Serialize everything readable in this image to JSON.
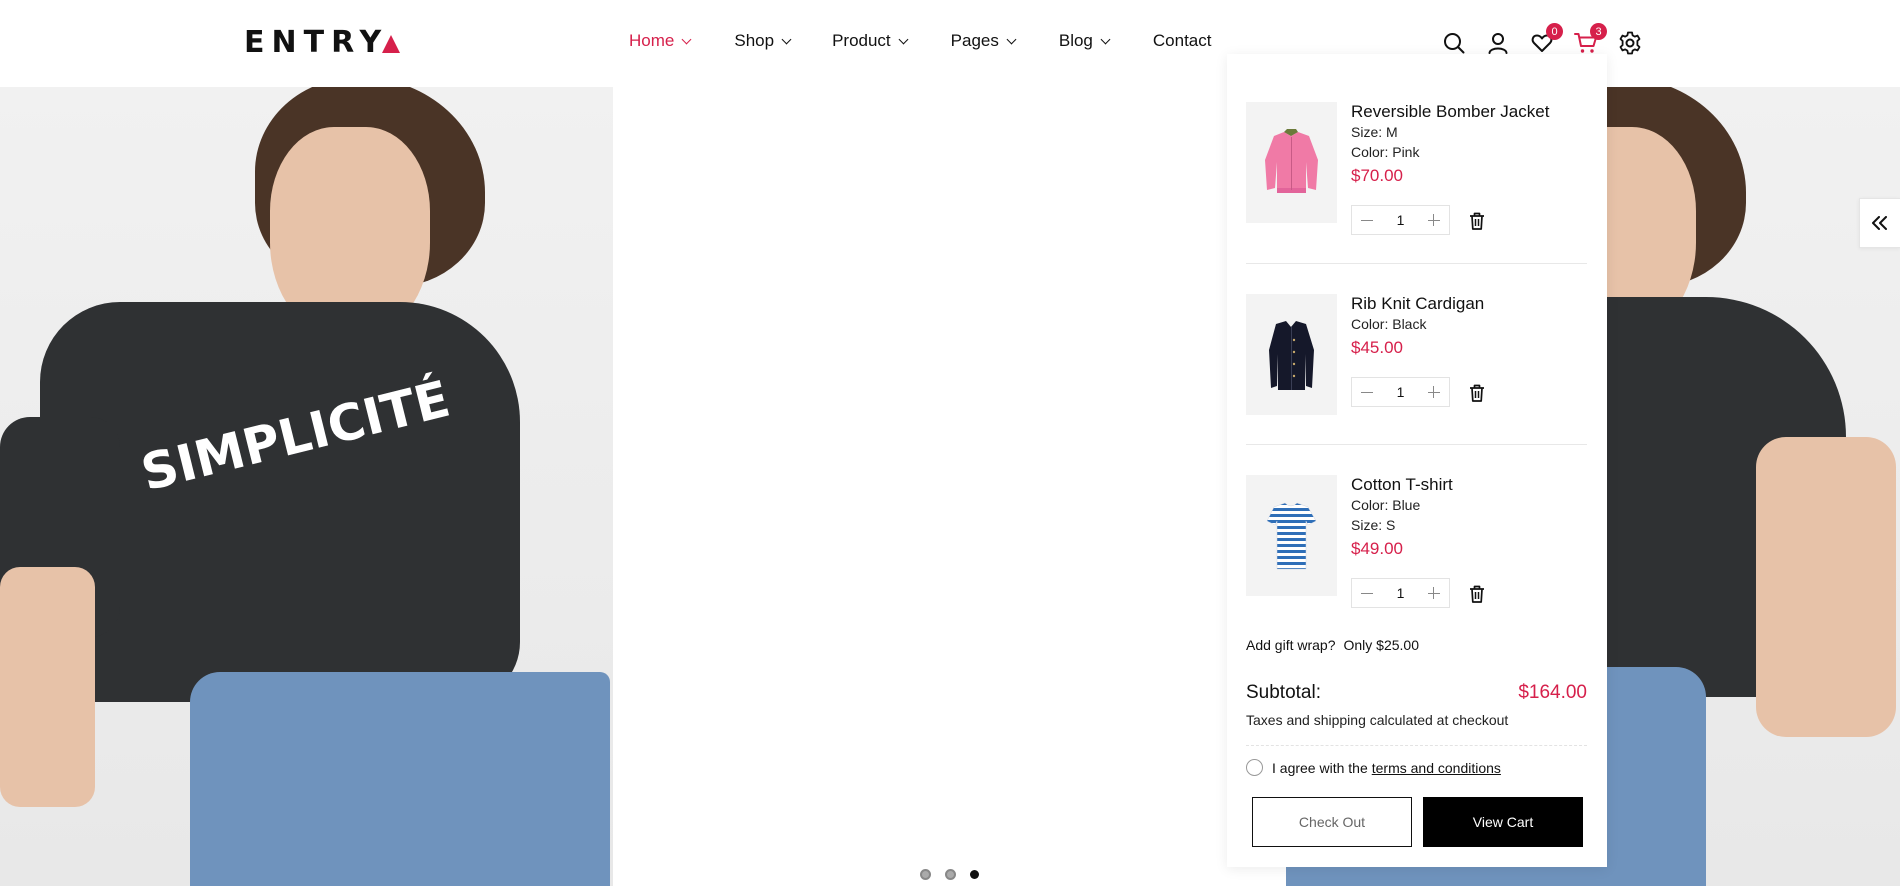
{
  "brand": {
    "logo_text": "ENTRY",
    "accent": "#d6204b"
  },
  "nav": {
    "items": [
      {
        "label": "Home",
        "active": true,
        "has_dropdown": true
      },
      {
        "label": "Shop",
        "has_dropdown": true
      },
      {
        "label": "Product",
        "has_dropdown": true
      },
      {
        "label": "Pages",
        "has_dropdown": true
      },
      {
        "label": "Blog",
        "has_dropdown": true
      },
      {
        "label": "Contact",
        "has_dropdown": false
      }
    ]
  },
  "header_icons": {
    "search": "search-icon",
    "account": "user-icon",
    "wishlist": {
      "icon": "heart-icon",
      "count": "0"
    },
    "cart": {
      "icon": "cart-icon",
      "count": "3"
    },
    "settings": "gear-icon"
  },
  "hero": {
    "print_text": "SIMPLICITÉ",
    "slide_count": 3,
    "active_slide": 3
  },
  "cart": {
    "items": [
      {
        "name": "Reversible Bomber Jacket",
        "attrs": [
          "Size: M",
          "Color: Pink"
        ],
        "price": "$70.00",
        "qty": "1",
        "thumb": "pink-bomber-jacket"
      },
      {
        "name": "Rib Knit Cardigan",
        "attrs": [
          "Color: Black"
        ],
        "price": "$45.00",
        "qty": "1",
        "thumb": "black-cardigan"
      },
      {
        "name": "Cotton T-shirt",
        "attrs": [
          "Color: Blue",
          "Size: S"
        ],
        "price": "$49.00",
        "qty": "1",
        "thumb": "striped-tshirt"
      }
    ],
    "gift_label": "Add gift wrap?",
    "gift_price": "Only $25.00",
    "subtotal_label": "Subtotal:",
    "subtotal_value": "$164.00",
    "taxes_note": "Taxes and shipping calculated at checkout",
    "agree_text": "I agree with the",
    "terms_link": "terms and conditions",
    "checkout_label": "Check Out",
    "viewcart_label": "View Cart"
  }
}
